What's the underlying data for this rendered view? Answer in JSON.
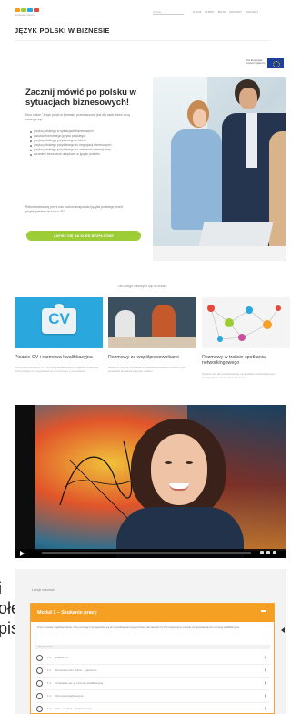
{
  "header": {
    "logo_sub": "language training",
    "search_placeholder": "Szukaj...",
    "nav": [
      "O NAS",
      "KURSY",
      "BLOG",
      "KONTAKT",
      "ZALOGUJ"
    ],
    "site_title": "JĘZYK POLSKI W BIZNESIE",
    "eu_badge": "Unia Europejska Fundusz Społeczny"
  },
  "hero": {
    "title": "Zacznij mówić po polsku w sytuacjach biznesowych!",
    "intro": "Kurs online \"Język polski w biznesie\" przeznaczony jest dla osób, które chcą nauczyć się:",
    "bullets": [
      "języka polskiego w sytuacjach biznesowych",
      "zwrotów formalnego języka polskiego",
      "języka polskiego przydatnego w biurze",
      "języka polskiego przydatnego do negocjacji biznesowych",
      "języka polskiego przydatnego do założenia własnej firmy",
      "rozumieć formularze urzędowe w języku polskim"
    ],
    "note": "Rekomendowany przez nas poziom znajomości języka polskiego przed przystąpieniem do kursu: B2",
    "cta_label": "ZAPISZ SIĘ NA KURS BEZPŁATNIE"
  },
  "courses": {
    "heading": "Oto czego nauczysz się na kursie:",
    "items": [
      {
        "title": "Pisanie CV i rozmowa kwalifikacyjna",
        "desc": "Wśród lekcji na temat CV i rozmowy kwalifikacyjnej znajdziesz materiały, które pomogą Ci przygotować się do rozmowy z pracodawcą."
      },
      {
        "title": "Rozmowy ze współpracownikami",
        "desc": "Nauczysz się, jak rozmawiać ze współpracownikami w biurze i jak prowadzić spotkania w języku polskim."
      },
      {
        "title": "Rozmowy w trakcie spotkania networkingowego",
        "desc": "Dowiesz się, jak przedstawić się na spotkaniu networkingowym i nawiązywać nowe kontakty biznesowe."
      }
    ],
    "cv_badge": "CV"
  },
  "edge_text": [
    "i",
    "ołe",
    "pis"
  ],
  "lessons": {
    "label": "Lekcje w kursie",
    "module_title": "Moduł 1 – Szukanie pracy",
    "module_desc": "W tym module znajdziesz lekcje, które pomogą Ci przygotować się do poszukiwania pracy w Polsce: jak napisać CV, list motywacyjny oraz jak przygotować się do rozmowy kwalifikacyjnej.",
    "progress_text": "0% ukończono",
    "items": [
      {
        "num": "1.1",
        "label": "Pisanie CV"
      },
      {
        "num": "1.2",
        "label": "Rozmowa przez telefon – ogłoszenie"
      },
      {
        "num": "1.3",
        "label": "Umawianie się na rozmowę kwalifikacyjną"
      },
      {
        "num": "1.4",
        "label": "Rozmowa kwalifikacyjna"
      },
      {
        "num": "1.5",
        "label": "Test – moduł 1 – Szukanie pracy"
      }
    ]
  },
  "colors": {
    "accent_orange": "#f5a023",
    "cta_green": "#9ccd36",
    "eu_blue": "#1e3f9a"
  }
}
